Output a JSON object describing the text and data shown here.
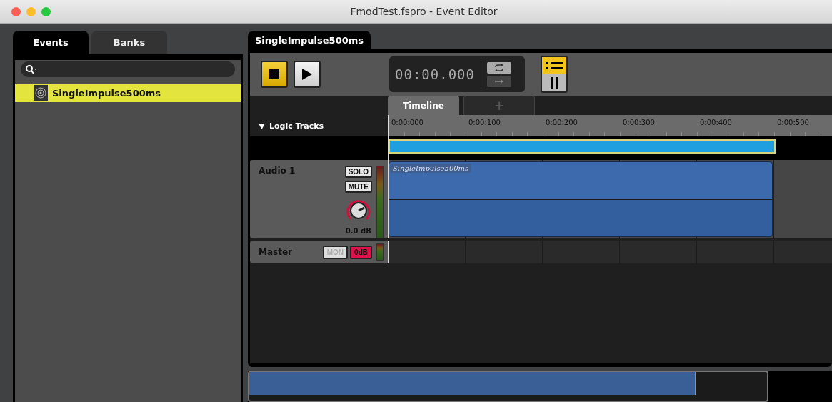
{
  "window": {
    "title": "FmodTest.fspro - Event Editor"
  },
  "browser": {
    "tabs": [
      {
        "label": "Events",
        "selected": true
      },
      {
        "label": "Banks",
        "selected": false
      }
    ],
    "items": [
      {
        "label": "SingleImpulse500ms",
        "selected": true
      }
    ]
  },
  "editor": {
    "tab": "SingleImpulse500ms",
    "time": "00:00.000",
    "view_tabs": [
      {
        "label": "Timeline",
        "selected": true
      },
      {
        "label": "+",
        "selected": false
      }
    ],
    "logic_tracks": "Logic Tracks",
    "ruler": [
      "0:00:000",
      "0:00:100",
      "0:00:200",
      "0:00:300",
      "0:00:400",
      "0:00:500"
    ],
    "tracks": [
      {
        "kind": "audio",
        "name": "Audio 1",
        "buttons": [
          "SOLO",
          "MUTE"
        ],
        "volume": "0.0 dB",
        "instrument": "SingleImpulse500ms"
      },
      {
        "kind": "master",
        "name": "Master",
        "buttons": [
          "MON",
          "0dB"
        ]
      }
    ],
    "overview": {
      "level": 0.86
    }
  }
}
